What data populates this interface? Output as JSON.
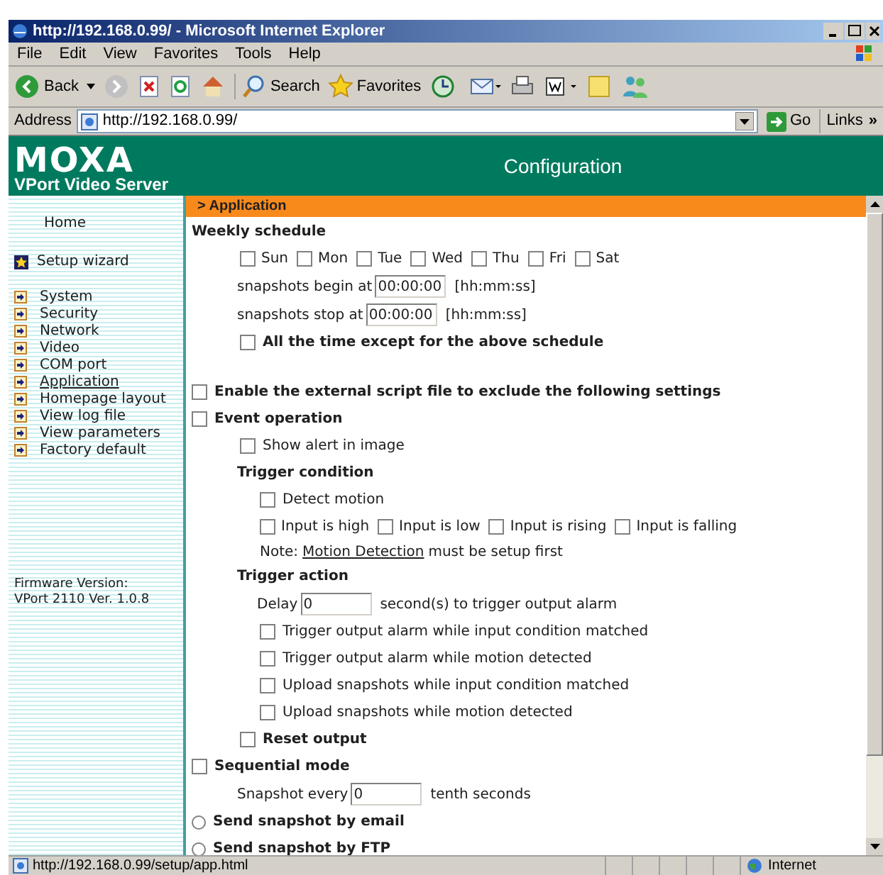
{
  "window": {
    "title": "http://192.168.0.99/ - Microsoft Internet Explorer"
  },
  "menu": [
    {
      "label": "File"
    },
    {
      "label": "Edit"
    },
    {
      "label": "View"
    },
    {
      "label": "Favorites"
    },
    {
      "label": "Tools"
    },
    {
      "label": "Help"
    }
  ],
  "toolbar": {
    "back": "Back",
    "search": "Search",
    "favorites": "Favorites"
  },
  "address": {
    "label": "Address",
    "value": "http://192.168.0.99/",
    "go": "Go",
    "links": "Links",
    "more": "»"
  },
  "banner": {
    "logo": "MOXA",
    "subtitle": "VPort Video Server",
    "title": "Configuration"
  },
  "sidebar": {
    "home": "Home",
    "wizard": "Setup wizard",
    "items": [
      {
        "label": "System",
        "selected": false
      },
      {
        "label": "Security",
        "selected": false
      },
      {
        "label": "Network",
        "selected": false
      },
      {
        "label": "Video",
        "selected": false
      },
      {
        "label": "COM port",
        "selected": false
      },
      {
        "label": "Application",
        "selected": true
      },
      {
        "label": "Homepage layout",
        "selected": false
      },
      {
        "label": "View log file",
        "selected": false
      },
      {
        "label": "View parameters",
        "selected": false
      },
      {
        "label": "Factory default",
        "selected": false
      }
    ],
    "firmware": [
      "Firmware Version:",
      "VPort 2110 Ver. 1.0.8"
    ]
  },
  "breadcrumb": "> Application",
  "form": [
    {
      "kind": "heading",
      "label": "Weekly schedule",
      "children": [
        {
          "kind": "days",
          "days": [
            {
              "label": "Sun",
              "checked": false
            },
            {
              "label": "Mon",
              "checked": false
            },
            {
              "label": "Tue",
              "checked": false
            },
            {
              "label": "Wed",
              "checked": false
            },
            {
              "label": "Thu",
              "checked": false
            },
            {
              "label": "Fri",
              "checked": false
            },
            {
              "label": "Sat",
              "checked": false
            }
          ]
        },
        {
          "kind": "input",
          "prefix": "snapshots begin at",
          "value": "00:00:00",
          "suffix": "[hh:mm:ss]"
        },
        {
          "kind": "input",
          "prefix": "snapshots stop at",
          "value": "00:00:00",
          "suffix": "[hh:mm:ss]"
        },
        {
          "kind": "checkbox",
          "label": "All the time except for the above schedule",
          "checked": false,
          "bold": true
        }
      ]
    },
    {
      "kind": "checkbox",
      "label": "Enable the external script file to exclude the following settings",
      "checked": false,
      "bold": true
    },
    {
      "kind": "checkbox",
      "label": "Event operation",
      "checked": false,
      "bold": true,
      "children": [
        {
          "kind": "checkbox",
          "label": "Show alert in image",
          "checked": false,
          "bold": false
        },
        {
          "kind": "heading",
          "label": "Trigger condition",
          "children": [
            {
              "kind": "checkbox",
              "label": "Detect motion",
              "checked": false,
              "bold": false
            },
            {
              "kind": "days",
              "days": [
                {
                  "label": "Input is high",
                  "checked": false
                },
                {
                  "label": "Input is low",
                  "checked": false
                },
                {
                  "label": "Input is rising",
                  "checked": false
                },
                {
                  "label": "Input is falling",
                  "checked": false
                }
              ]
            },
            {
              "kind": "note",
              "prefix": "Note:",
              "link": "Motion Detection",
              "suffix": "must be setup first"
            }
          ]
        },
        {
          "kind": "heading",
          "label": "Trigger action",
          "children": [
            {
              "kind": "input",
              "prefix": "Delay",
              "value": "0",
              "suffix": "second(s) to trigger output alarm"
            },
            {
              "kind": "checkbox",
              "label": "Trigger output alarm while input condition matched",
              "checked": false,
              "bold": false
            },
            {
              "kind": "checkbox",
              "label": "Trigger output alarm while motion detected",
              "checked": false,
              "bold": false
            },
            {
              "kind": "checkbox",
              "label": "Upload snapshots while input condition matched",
              "checked": false,
              "bold": false
            },
            {
              "kind": "checkbox",
              "label": "Upload snapshots while motion detected",
              "checked": false,
              "bold": false
            }
          ]
        },
        {
          "kind": "checkbox",
          "label": "Reset output",
          "checked": false,
          "bold": true
        }
      ]
    },
    {
      "kind": "checkbox",
      "label": "Sequential mode",
      "checked": false,
      "bold": true,
      "children": [
        {
          "kind": "input",
          "prefix": "Snapshot every",
          "value": "0",
          "suffix": "tenth seconds"
        }
      ]
    },
    {
      "kind": "radio",
      "label": "Send snapshot by email",
      "selected": false
    },
    {
      "kind": "radio",
      "label": "Send snapshot by FTP",
      "selected": false
    }
  ],
  "status_bar": {
    "url": "http://192.168.0.99/setup/app.html",
    "zone": "Internet"
  }
}
